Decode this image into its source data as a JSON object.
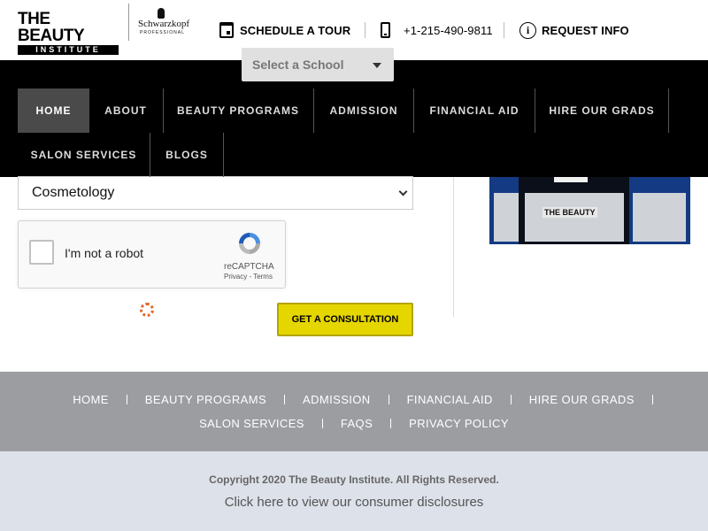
{
  "header": {
    "logo": {
      "line1": "THE BEAUTY",
      "line2": "INSTITUTE"
    },
    "partner_logo": {
      "name": "Schwarzkopf",
      "sub": "PROFESSIONAL"
    },
    "schedule_tour": "SCHEDULE A TOUR",
    "phone": "+1-215-490-9811",
    "request_info": "REQUEST INFO",
    "school_select": {
      "selected": "Select a School"
    }
  },
  "nav": {
    "items": [
      {
        "label": "HOME",
        "active": true
      },
      {
        "label": "ABOUT"
      },
      {
        "label": "BEAUTY PROGRAMS"
      },
      {
        "label": "ADMISSION"
      },
      {
        "label": "FINANCIAL AID"
      },
      {
        "label": "HIRE OUR GRADS"
      },
      {
        "label": "SALON SERVICES"
      },
      {
        "label": "BLOGS"
      }
    ]
  },
  "form": {
    "program_select": {
      "selected": "Cosmetology"
    },
    "recaptcha": {
      "label": "I'm not a robot",
      "brand": "reCAPTCHA",
      "links": "Privacy - Terms"
    },
    "submit_label": "GET A CONSULTATION"
  },
  "store_photo": {
    "sign_text": "THE BEAUTY"
  },
  "footer": {
    "row1": [
      "HOME",
      "BEAUTY PROGRAMS",
      "ADMISSION",
      "FINANCIAL AID",
      "HIRE OUR GRADS"
    ],
    "row2": [
      "SALON SERVICES",
      "FAQS",
      "PRIVACY POLICY"
    ],
    "copyright": "Copyright 2020 The Beauty Institute. All Rights Reserved.",
    "disclosure_link": "Click here to view our consumer disclosures"
  },
  "colors": {
    "nav_bg": "#000000",
    "nav_active": "#4a4a4a",
    "cta": "#e5d600",
    "footer_nav_bg": "#9b9da1",
    "footer_bottom_bg": "#dde1ea"
  },
  "icons": [
    "calendar-icon",
    "phone-icon",
    "info-icon",
    "chevron-down-icon",
    "spinner-icon"
  ]
}
